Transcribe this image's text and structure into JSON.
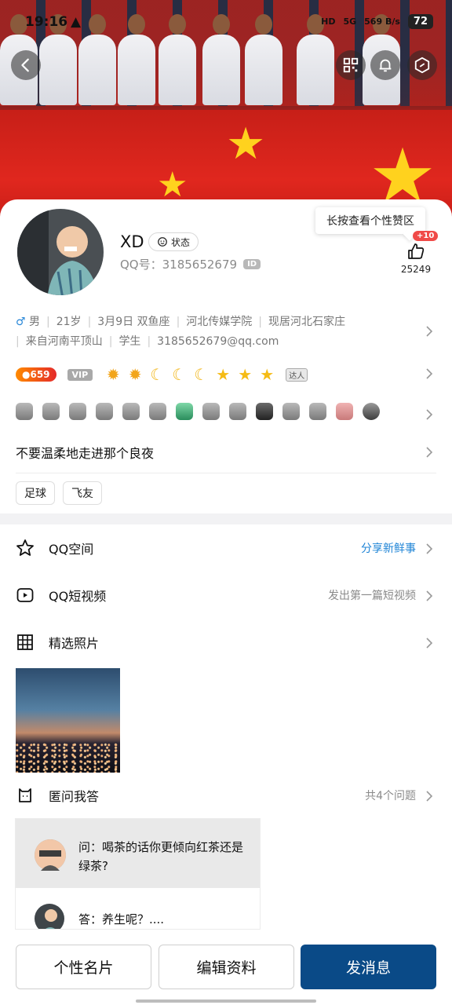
{
  "status_bar": {
    "time": "19:16",
    "alert": "▲",
    "hd": "HD",
    "signal": "5G",
    "speed": "569 B/s",
    "battery": "72"
  },
  "nav": {
    "back_icon": "back-arrow-icon",
    "qr_icon": "qr-code-icon",
    "bell_icon": "bell-icon",
    "settings_icon": "hexagon-settings-icon"
  },
  "profile": {
    "nickname": "XD",
    "status_label": "状态",
    "qq_label": "QQ号：3185652679",
    "id_badge": "ID"
  },
  "like": {
    "tooltip": "长按查看个性赞区",
    "plus": "+10",
    "count": "25249"
  },
  "info": {
    "gender_icon": "♂",
    "gender": "男",
    "age": "21岁",
    "birthday": "3月9日",
    "zodiac": "双鱼座",
    "school": "河北传媒学院",
    "residence": "现居河北石家庄",
    "hometown": "来自河南平顶山",
    "occupation": "学生",
    "email": "3185652679@qq.com"
  },
  "level": {
    "value": "659",
    "vip": "VIP",
    "daren": "达人"
  },
  "signature": "不要温柔地走进那个良夜",
  "tags": [
    "足球",
    "飞友"
  ],
  "rows": {
    "qzone": {
      "label": "QQ空间",
      "aside": "分享新鲜事",
      "icon": "star-icon"
    },
    "video": {
      "label": "QQ短视频",
      "aside": "发出第一篇短视频",
      "icon": "video-icon"
    },
    "photos": {
      "label": "精选照片",
      "icon": "grid-icon"
    },
    "qa": {
      "label": "匿问我答",
      "aside": "共4个问题",
      "icon": "cat-box-icon"
    }
  },
  "qa_card": {
    "question": "问：喝茶的话你更倾向红茶还是绿茶?",
    "answer": "答：养生呢？...."
  },
  "buttons": {
    "card": "个性名片",
    "edit": "编辑资料",
    "message": "发消息"
  },
  "colors": {
    "primary": "#0a4a87",
    "link_blue": "#1f84d6",
    "badge_red": "#f04a48"
  }
}
